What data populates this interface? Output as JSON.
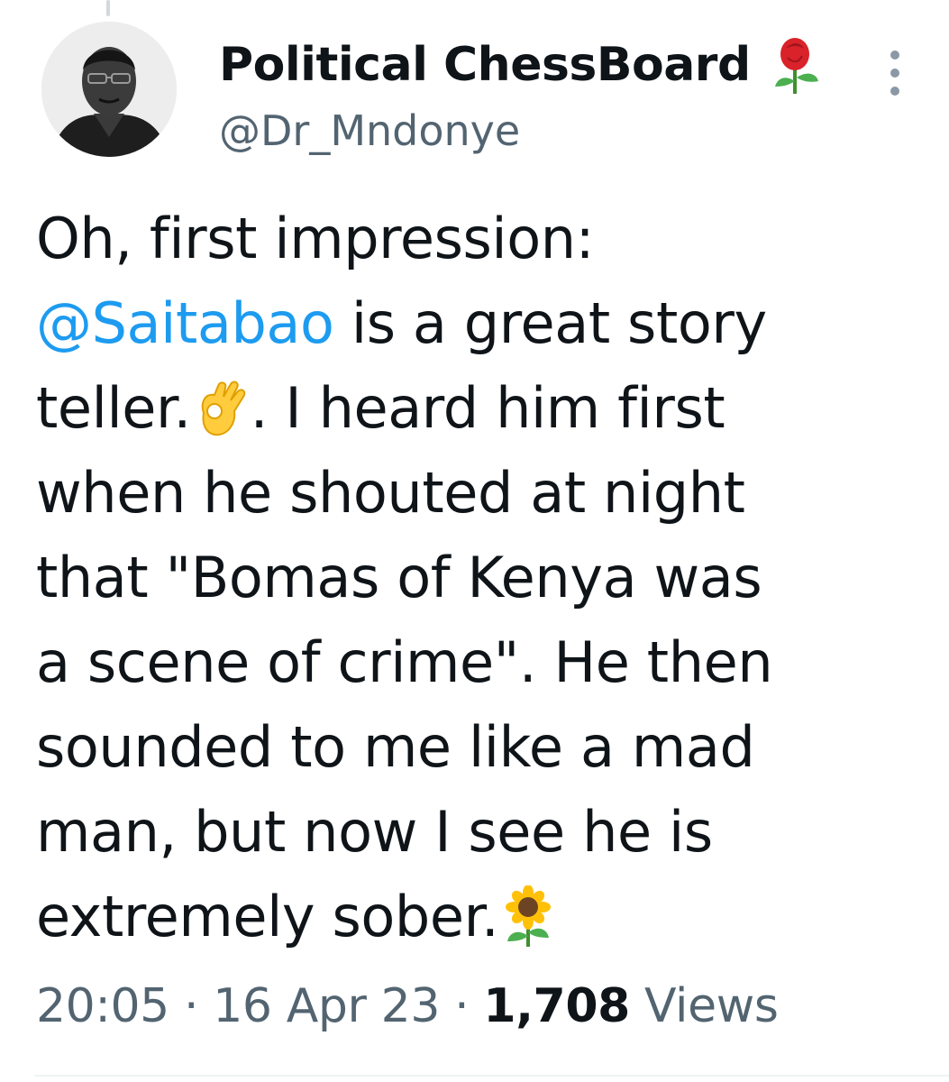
{
  "tweet": {
    "author": {
      "name": "Political ChessBoard",
      "name_emoji": "rose-emoji",
      "handle": "@Dr_Mndonye"
    },
    "more_icon": "more-vertical-icon",
    "body": {
      "line1": "Oh, first impression:",
      "mention": "@Saitabao",
      "line2_rest": " is a great story",
      "line3_start": "teller.",
      "line3_emoji": "ok-hand-emoji",
      "line3_rest": ".  I heard him first",
      "line4": "when he shouted at night",
      "line5": "that \"Bomas of Kenya was",
      "line6": "a scene of crime\". He then",
      "line7": "sounded to me like a mad",
      "line8": "man, but now I see he is",
      "line9": "extremely sober.",
      "line9_emoji": "sunflower-emoji"
    },
    "meta": {
      "time": "20:05",
      "separator": " · ",
      "date": "16 Apr 23",
      "views_count": "1,708",
      "views_label": " Views"
    }
  },
  "colors": {
    "link": "#1d9bf0",
    "secondary_text": "#536471",
    "primary_text": "#0f1419"
  }
}
